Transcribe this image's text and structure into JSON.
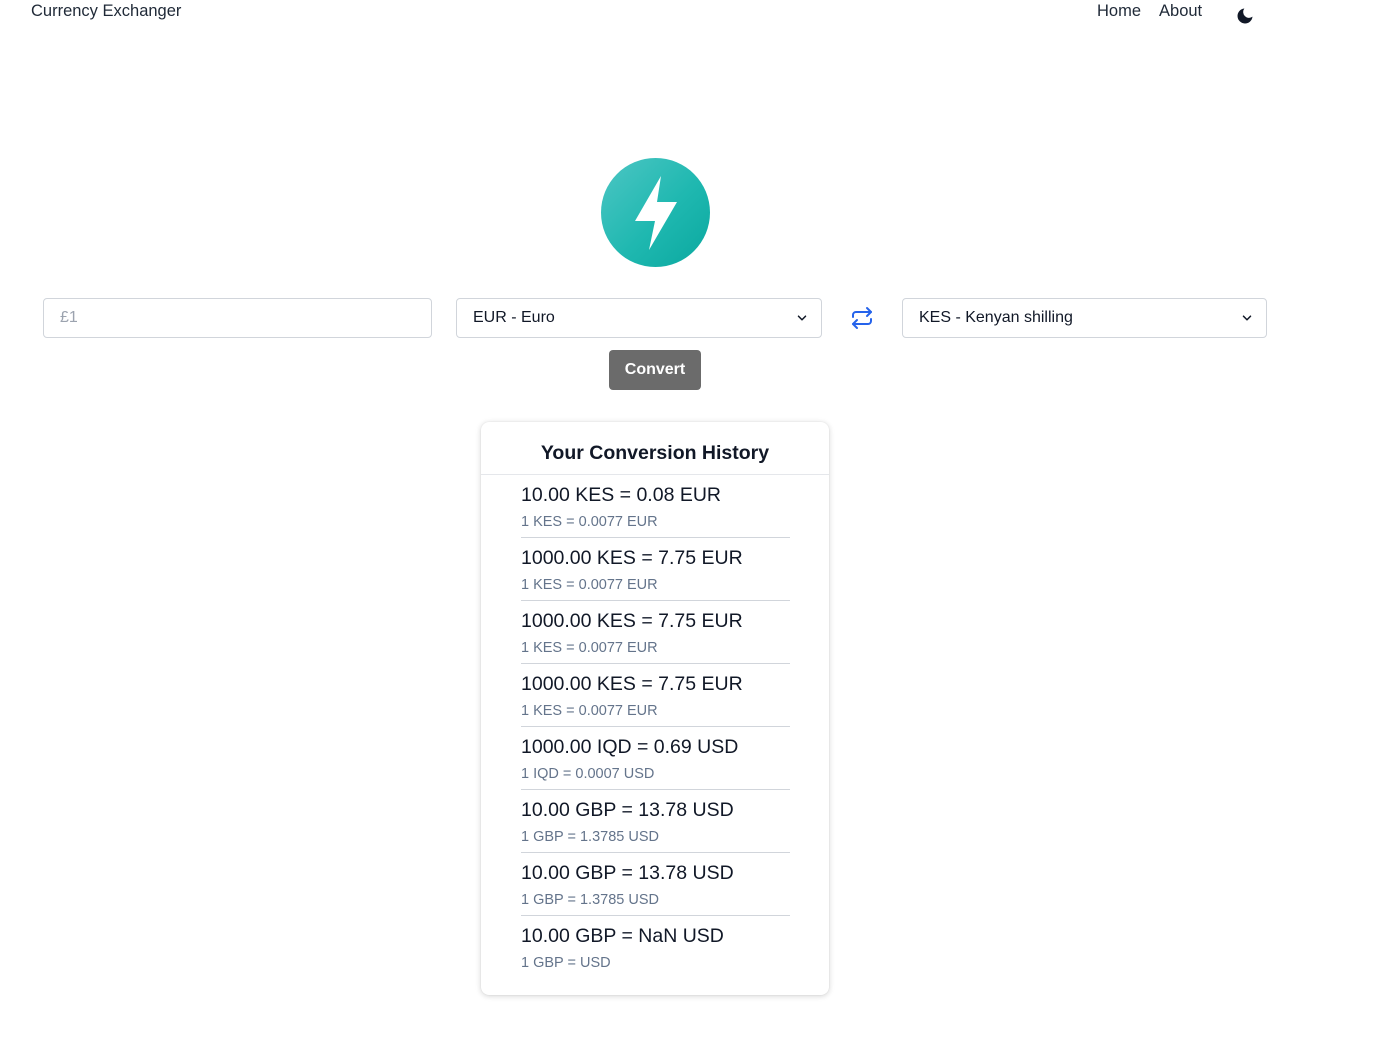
{
  "nav": {
    "brand": "Currency Exchanger",
    "links": [
      {
        "label": "Home"
      },
      {
        "label": "About"
      }
    ],
    "theme_icon": "moon-icon"
  },
  "logo": {
    "icon": "lightning-bolt-icon",
    "color": "#1fb8b0"
  },
  "form": {
    "amount_placeholder": "£1",
    "amount_value": "",
    "from_currency": "EUR - Euro",
    "to_currency": "KES - Kenyan shilling",
    "swap_icon": "swap-arrows-icon",
    "convert_label": "Convert"
  },
  "history": {
    "title": "Your Conversion History",
    "items": [
      {
        "main": "10.00 KES = 0.08 EUR",
        "rate": "1 KES = 0.0077 EUR"
      },
      {
        "main": "1000.00 KES = 7.75 EUR",
        "rate": "1 KES = 0.0077 EUR"
      },
      {
        "main": "1000.00 KES = 7.75 EUR",
        "rate": "1 KES = 0.0077 EUR"
      },
      {
        "main": "1000.00 KES = 7.75 EUR",
        "rate": "1 KES = 0.0077 EUR"
      },
      {
        "main": "1000.00 IQD = 0.69 USD",
        "rate": "1 IQD = 0.0007 USD"
      },
      {
        "main": "10.00 GBP = 13.78 USD",
        "rate": "1 GBP = 1.3785 USD"
      },
      {
        "main": "10.00 GBP = 13.78 USD",
        "rate": "1 GBP = 1.3785 USD"
      },
      {
        "main": "10.00 GBP = NaN USD",
        "rate": "1 GBP = USD"
      }
    ]
  },
  "colors": {
    "accent_blue": "#2563eb",
    "convert_button": "#6b6b6b",
    "muted_text": "#64748b"
  }
}
